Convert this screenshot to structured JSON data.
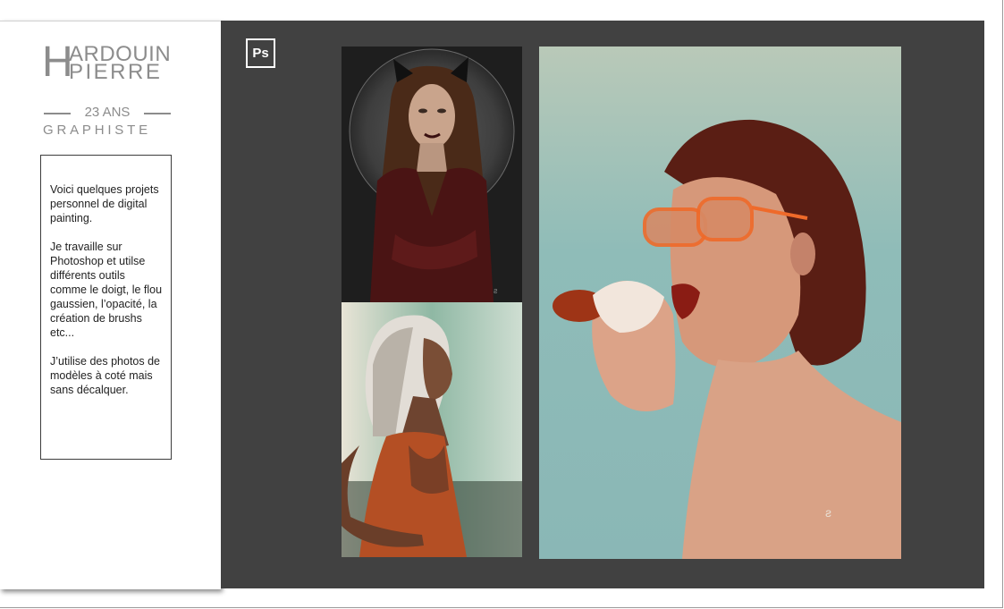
{
  "header": {
    "initial": "H",
    "first_name_rest": "ARDOUIN",
    "last_name": "PIERRE",
    "age": "23 ANS",
    "job": "GRAPHISTE"
  },
  "description": {
    "paragraph_1": "Voici quelques projets personnel de digital painting.",
    "paragraph_2": "Je travaille sur Photoshop et utilse différents outils comme le doigt, le flou gaussien, l’opacité, la création de brushs etc...",
    "paragraph_3": "J’utilise des photos de modèles à coté mais sans décalquer."
  },
  "software_badge": "Ps",
  "colors": {
    "panel_background": "#414141",
    "logo_gray": "#8c8c8c",
    "page_background": "#ffffff"
  },
  "artworks": [
    {
      "subject": "woman with cat ears in dark bodysuit"
    },
    {
      "subject": "woman with white hair in orange top"
    },
    {
      "subject": "woman with orange sunglasses eating a hot dog"
    }
  ]
}
